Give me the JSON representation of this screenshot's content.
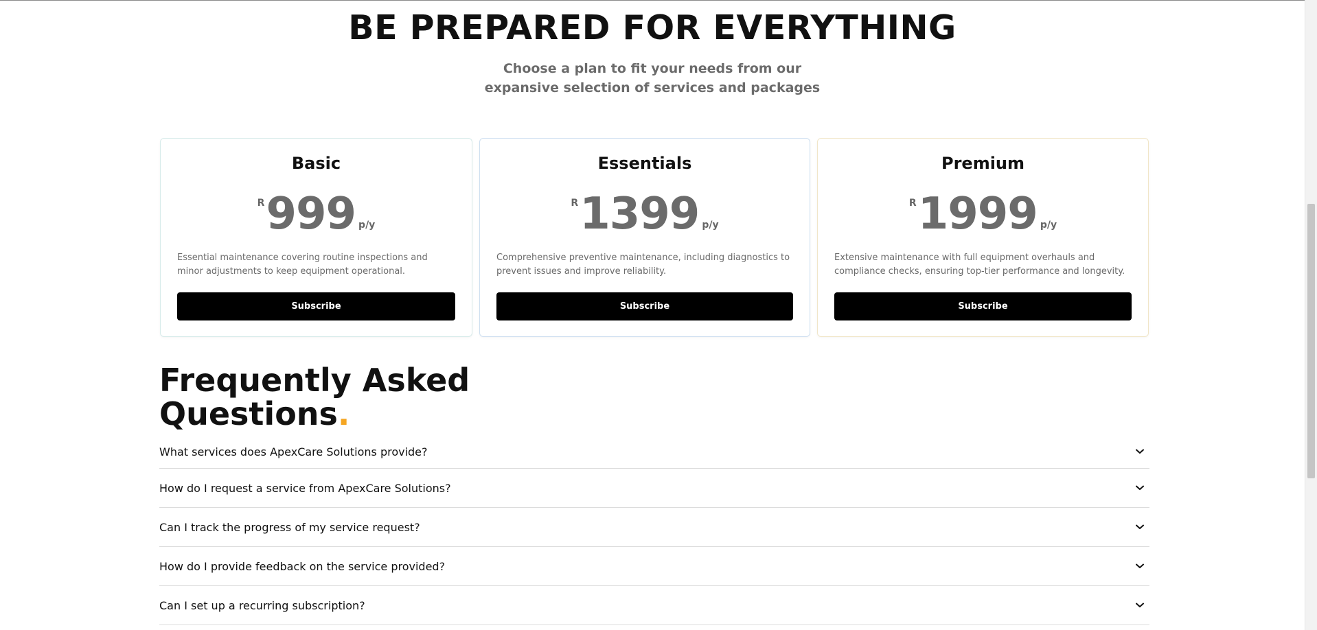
{
  "hero": {
    "title": "BE PREPARED FOR EVERYTHING",
    "subtitle": "Choose a plan to fit your needs from our expansive selection of services and packages"
  },
  "plans": [
    {
      "name": "Basic",
      "currency": "R",
      "amount": "999",
      "period": "p/y",
      "description": "Essential maintenance covering routine inspections and minor adjustments to keep equipment operational.",
      "button": "Subscribe"
    },
    {
      "name": "Essentials",
      "currency": "R",
      "amount": "1399",
      "period": "p/y",
      "description": "Comprehensive preventive maintenance, including diagnostics to prevent issues and improve reliability.",
      "button": "Subscribe"
    },
    {
      "name": "Premium",
      "currency": "R",
      "amount": "1999",
      "period": "p/y",
      "description": "Extensive maintenance with full equipment overhauls and compliance checks, ensuring top-tier performance and longevity.",
      "button": "Subscribe"
    }
  ],
  "faq": {
    "title_line1": "Frequently Asked",
    "title_line2": "Questions",
    "title_dot": ".",
    "accent_color": "#f5a623",
    "questions": [
      "What services does ApexCare Solutions provide?",
      "How do I request a service from ApexCare Solutions?",
      "Can I track the progress of my service request?",
      "How do I provide feedback on the service provided?",
      "Can I set up a recurring subscription?"
    ],
    "expand_icon": "chevron-down-icon"
  }
}
